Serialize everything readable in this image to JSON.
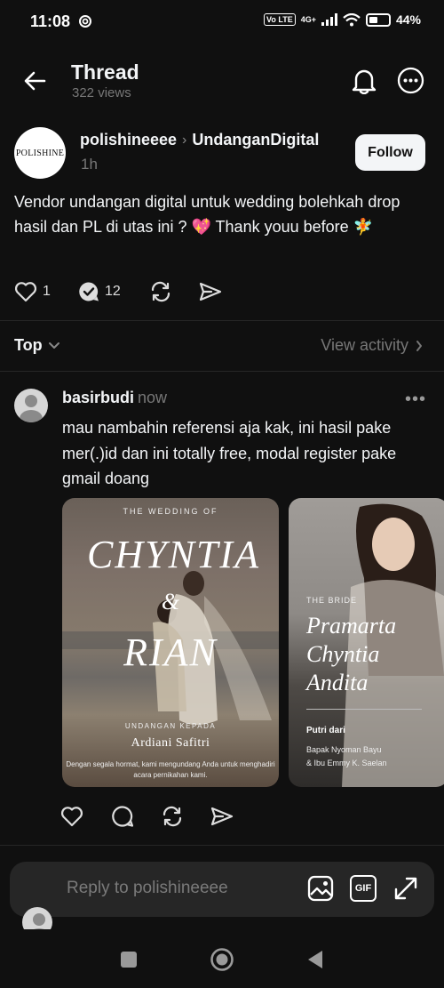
{
  "status_bar": {
    "time": "11:08",
    "volte": "Vo LTE",
    "network": "4G+",
    "battery": "44%"
  },
  "header": {
    "title": "Thread",
    "views": "322 views"
  },
  "post": {
    "author": "polishineeee",
    "community": "UndanganDigital",
    "time": "1h",
    "avatar_text": "POLISHINE",
    "follow_label": "Follow",
    "text": "Vendor undangan digital untuk wedding bolehkah drop hasil dan PL di utas ini ? 💖 Thank youu before 🧚",
    "likes": "1",
    "replies": "12"
  },
  "sort": {
    "label": "Top",
    "view_activity": "View activity"
  },
  "reply": {
    "author": "basirbudi",
    "time": "now",
    "text": "mau nambahin referensi aja kak, ini hasil pake mer(.)id dan ini totally free, modal register pake gmail doang",
    "card1": {
      "heading": "THE WEDDING OF",
      "name1": "CHYNTIA",
      "amp": "&",
      "name2": "RIAN",
      "invite_label": "UNDANGAN KEPADA",
      "guest": "Ardiani Safitri",
      "message": "Dengan segala hormat, kami mengundang Anda untuk menghadiri acara pernikahan kami."
    },
    "card2": {
      "label": "THE BRIDE",
      "name_line1": "Pramarta",
      "name_line2": "Chyntia",
      "name_line3": "Andita",
      "daughter_of": "Putri dari",
      "parents_line1": "Bapak Nyoman Bayu",
      "parents_line2": "& Ibu Emmy K. Saelan"
    }
  },
  "composer": {
    "placeholder": "Reply to polishineeee",
    "gif": "GIF"
  }
}
